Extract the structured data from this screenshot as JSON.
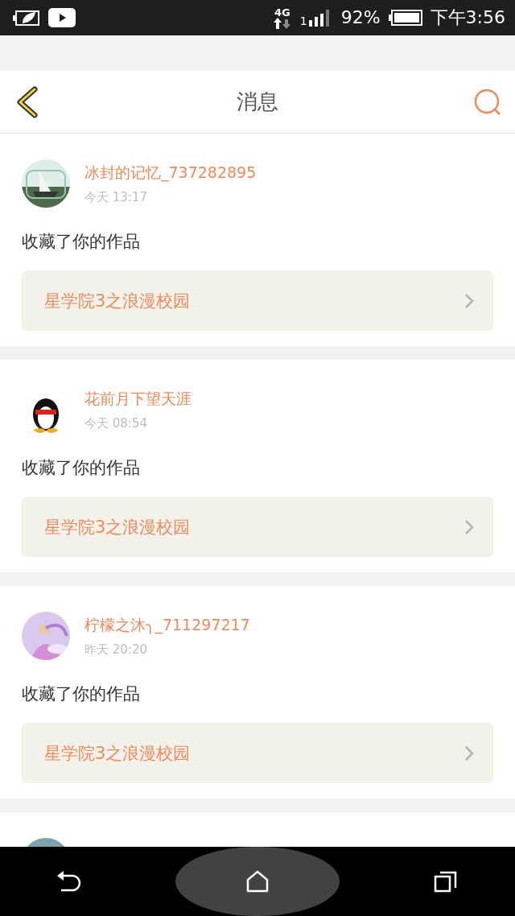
{
  "status_bar": {
    "network": "4G",
    "sim": "1",
    "battery": "92%",
    "time": "下午3:56"
  },
  "header": {
    "title": "消息"
  },
  "messages": [
    {
      "name": "冰封的记忆_737282895",
      "time": "今天 13:17",
      "action": "收藏了你的作品",
      "work": "星学院3之浪漫校园"
    },
    {
      "name": "花前月下望天涯",
      "time": "今天 08:54",
      "action": "收藏了你的作品",
      "work": "星学院3之浪漫校园"
    },
    {
      "name": "柠檬之沐╮_711297217",
      "time": "昨天 20:20",
      "action": "收藏了你的作品",
      "work": "星学院3之浪漫校园"
    }
  ]
}
